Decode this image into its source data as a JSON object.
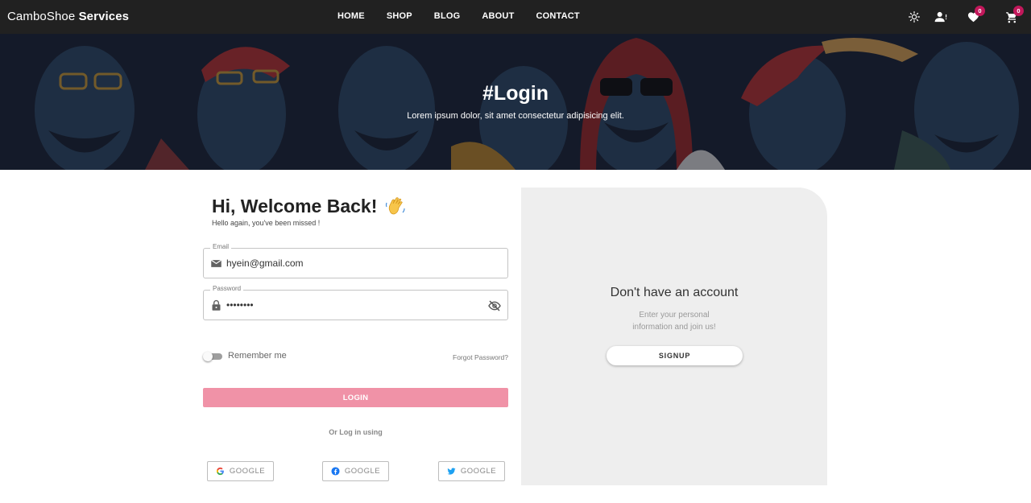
{
  "brand": {
    "name_light": "CamboShoe",
    "name_bold": "Services"
  },
  "nav": {
    "items": [
      "HOME",
      "SHOP",
      "BLOG",
      "ABOUT",
      "CONTACT"
    ]
  },
  "header_icons": {
    "theme": "sun-icon",
    "account": "user-icon",
    "wishlist": {
      "icon": "heart-icon",
      "count": "0"
    },
    "cart": {
      "icon": "cart-icon",
      "count": "0"
    }
  },
  "hero": {
    "title": "#Login",
    "subtitle": "Lorem ipsum dolor, sit amet consectetur adipisicing elit."
  },
  "login": {
    "title": "Hi, Welcome Back!",
    "subtitle": "Hello again, you've been missed !",
    "email": {
      "label": "Email",
      "value": "hyein@gmail.com"
    },
    "password": {
      "label": "Password",
      "value": "••••••••"
    },
    "remember_label": "Remember me",
    "forgot_label": "Forgot Password?",
    "login_button": "LOGIN",
    "or_text": "Or Log in using",
    "social": [
      {
        "label": "GOOGLE",
        "icon": "google-icon"
      },
      {
        "label": "GOOGLE",
        "icon": "facebook-icon"
      },
      {
        "label": "GOOGLE",
        "icon": "twitter-icon"
      }
    ]
  },
  "signup_panel": {
    "title": "Don't have an account",
    "text_line1": "Enter your personal",
    "text_line2": "information and join us!",
    "button": "SIGNUP"
  },
  "colors": {
    "navbar": "#212121",
    "accent_pink": "#f092a7",
    "badge": "#c2185b",
    "panel": "#eeeeee"
  }
}
